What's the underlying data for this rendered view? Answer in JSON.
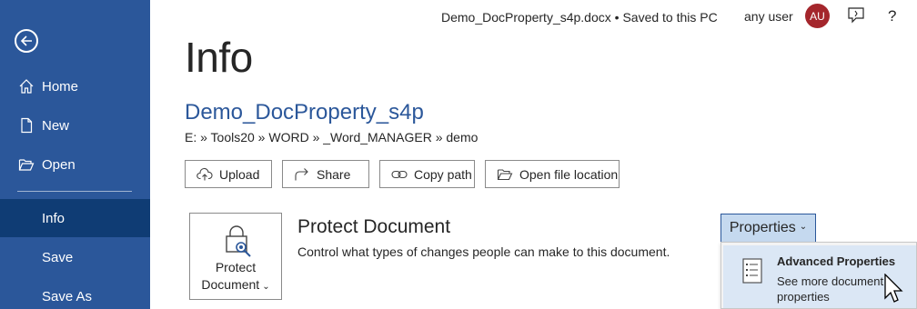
{
  "sidebar": {
    "back_icon": "back-arrow-icon",
    "items": [
      {
        "label": "Home",
        "icon": "home-icon"
      },
      {
        "label": "New",
        "icon": "new-document-icon"
      },
      {
        "label": "Open",
        "icon": "open-folder-icon"
      },
      {
        "label": "Info",
        "active": true
      },
      {
        "label": "Save"
      },
      {
        "label": "Save As"
      }
    ],
    "bg_color": "#2b579a",
    "active_color": "#0f3c74"
  },
  "topbar": {
    "document_status": "Demo_DocProperty_s4p.docx • Saved to this PC",
    "user_name": "any user",
    "avatar_initials": "AU",
    "avatar_color": "#a4262c",
    "help_label": "?"
  },
  "main": {
    "title": "Info",
    "doc_name": "Demo_DocProperty_s4p",
    "doc_path": "E: » Tools20 » WORD » _Word_MANAGER » demo",
    "buttons": {
      "upload": "Upload",
      "share": "Share",
      "copy_path": "Copy path",
      "open_location": "Open file location"
    },
    "protect": {
      "button_line1": "Protect",
      "button_line2": "Document",
      "heading": "Protect Document",
      "description": "Control what types of changes people can make to this document."
    },
    "properties": {
      "button_label": "Properties",
      "menu_item_title": "Advanced Properties",
      "menu_item_desc": "See more document properties"
    }
  }
}
